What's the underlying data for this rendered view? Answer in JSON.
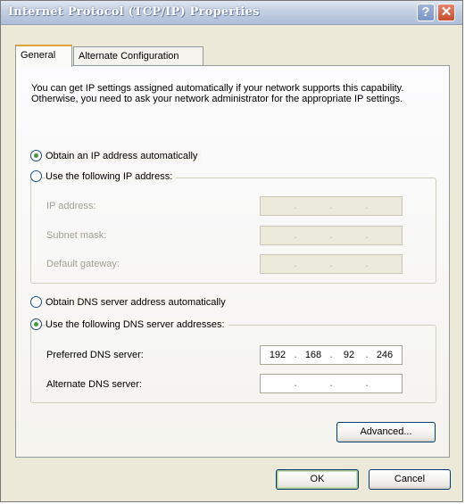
{
  "window": {
    "title": "Internet Protocol (TCP/IP) Properties",
    "help_label": "?",
    "close_label": "✕"
  },
  "tabs": [
    {
      "label": "General",
      "selected": true
    },
    {
      "label": "Alternate Configuration",
      "selected": false
    }
  ],
  "intro_text": "You can get IP settings assigned automatically if your network supports this capability. Otherwise, you need to ask your network administrator for the appropriate IP settings.",
  "ip": {
    "auto_label": "Obtain an IP address automatically",
    "auto_selected": true,
    "manual_label": "Use the following IP address:",
    "manual_selected": false,
    "fields": [
      {
        "label": "IP address:",
        "octets": [
          "",
          "",
          "",
          ""
        ],
        "enabled": false
      },
      {
        "label": "Subnet mask:",
        "octets": [
          "",
          "",
          "",
          ""
        ],
        "enabled": false
      },
      {
        "label": "Default gateway:",
        "octets": [
          "",
          "",
          "",
          ""
        ],
        "enabled": false
      }
    ]
  },
  "dns": {
    "auto_label": "Obtain DNS server address automatically",
    "auto_selected": false,
    "manual_label": "Use the following DNS server addresses:",
    "manual_selected": true,
    "fields": [
      {
        "label": "Preferred DNS server:",
        "octets": [
          "192",
          "168",
          "92",
          "246"
        ],
        "enabled": true
      },
      {
        "label": "Alternate DNS server:",
        "octets": [
          "",
          "",
          "",
          ""
        ],
        "enabled": true
      }
    ]
  },
  "buttons": {
    "advanced": "Advanced...",
    "ok": "OK",
    "cancel": "Cancel"
  },
  "colors": {
    "dialog_background": "#ece9d8",
    "radio_selected_dot": "#3f9c35",
    "button_border": "#003c74"
  }
}
